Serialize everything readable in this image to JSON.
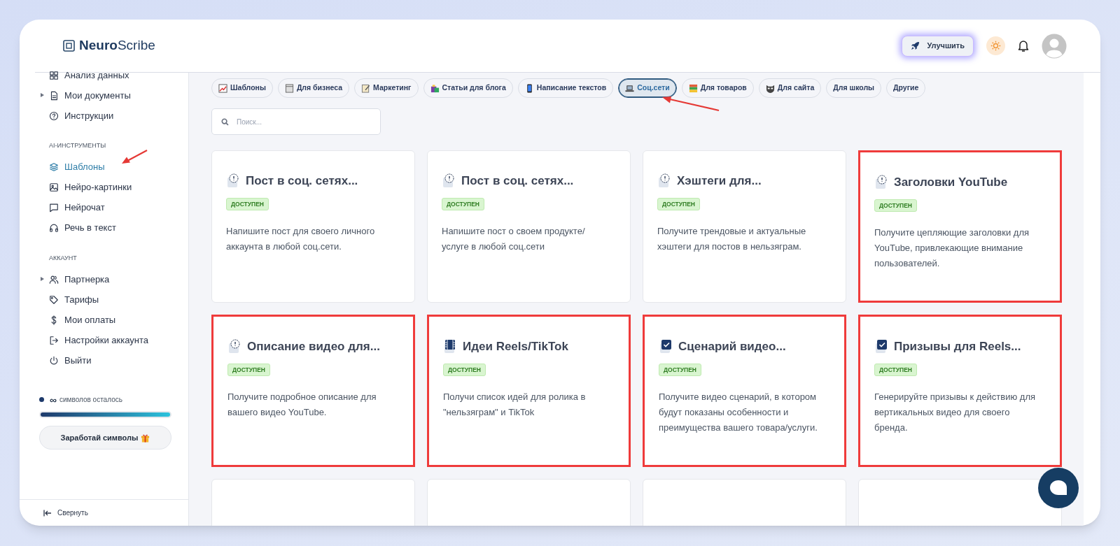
{
  "logo": {
    "bold": "Neuro",
    "light": "Scribe"
  },
  "header": {
    "upgrade_label": "Улучшить"
  },
  "sidebar": {
    "sections": [
      {
        "items": [
          {
            "label": "Анализ данных",
            "selected": false
          },
          {
            "label": "Мои документы",
            "selected": false,
            "expanded": false
          },
          {
            "label": "Инструкции",
            "selected": false
          }
        ]
      },
      {
        "title": "AI-ИНСТРУМЕНТЫ",
        "items": [
          {
            "label": "Шаблоны",
            "selected": true
          },
          {
            "label": "Нейро-картинки",
            "selected": false
          },
          {
            "label": "Нейрочат",
            "selected": false
          },
          {
            "label": "Речь в текст",
            "selected": false
          }
        ]
      },
      {
        "title": "АККАУНТ",
        "items": [
          {
            "label": "Партнерка",
            "selected": false,
            "expanded": false
          },
          {
            "label": "Тарифы",
            "selected": false
          },
          {
            "label": "Мои оплаты",
            "selected": false
          },
          {
            "label": "Настройки аккаунта",
            "selected": false
          },
          {
            "label": "Выйти",
            "selected": false
          }
        ]
      }
    ],
    "symbols": {
      "count": "∞",
      "label": "символов осталось",
      "level": 1
    },
    "earn_button": "Заработай символы",
    "collapse": "Свернуть"
  },
  "tabs": [
    {
      "label": "Шаблоны",
      "selected": false
    },
    {
      "label": "Для бизнеса",
      "selected": false
    },
    {
      "label": "Маркетинг",
      "selected": false
    },
    {
      "label": "Статьи для блога",
      "selected": false
    },
    {
      "label": "Написание текстов",
      "selected": false
    },
    {
      "label": "Соц.сети",
      "selected": true
    },
    {
      "label": "Для товаров",
      "selected": false
    },
    {
      "label": "Для сайта",
      "selected": false
    },
    {
      "label": "Для школы",
      "selected": false
    },
    {
      "label": "Другие",
      "selected": false
    }
  ],
  "search": {
    "placeholder": "Поиск..."
  },
  "cards": [
    {
      "title": "Пост в соц. сетях...",
      "badge": "ДОСТУПЕН",
      "description": "Напишите пост для своего личного аккаунта в любой соц.сети.",
      "highlighted": false
    },
    {
      "title": "Пост в соц. сетях...",
      "badge": "ДОСТУПЕН",
      "description": "Напишите пост о своем продукте/ услуге в любой соц.сети",
      "highlighted": false
    },
    {
      "title": "Хэштеги для...",
      "badge": "ДОСТУПЕН",
      "description": "Получите трендовые и актуальные хэштеги для постов в нельзяграм.",
      "highlighted": false
    },
    {
      "title": "Заголовки YouTube",
      "badge": "ДОСТУПЕН",
      "description": "Получите цепляющие заголовки для YouTube, привлекающие внимание пользователей.",
      "highlighted": true
    },
    {
      "title": "Описание видео для...",
      "badge": "ДОСТУПЕН",
      "description": "Получите подробное описание для вашего видео YouTube.",
      "highlighted": true
    },
    {
      "title": "Идеи Reels/TikTok",
      "badge": "ДОСТУПЕН",
      "description": "Получи список идей для ролика в \"нельзяграм\" и TikTok",
      "highlighted": true
    },
    {
      "title": "Сценарий видео...",
      "badge": "ДОСТУПЕН",
      "description": "Получите видео сценарий, в котором будут показаны особенности и преимущества вашего товара/услуги.",
      "highlighted": true
    },
    {
      "title": "Призывы для Reels...",
      "badge": "ДОСТУПЕН",
      "description": "Генерируйте призывы к действию для вертикальных видео для своего бренда.",
      "highlighted": true
    }
  ]
}
